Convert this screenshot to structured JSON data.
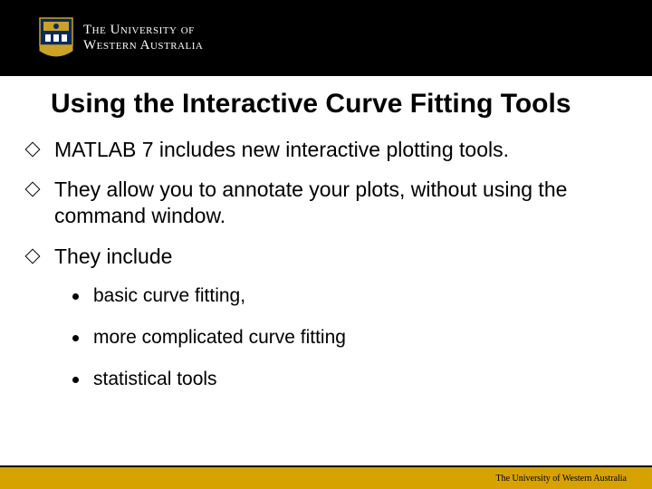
{
  "header": {
    "uni_line1": "The University of",
    "uni_line2": "Western Australia"
  },
  "title": "Using the Interactive Curve Fitting Tools",
  "bullets": [
    {
      "text": "MATLAB 7 includes new interactive plotting tools."
    },
    {
      "text": "They allow you to annotate your plots, without using the command window."
    },
    {
      "text": "They include",
      "sub": [
        "basic curve fitting,",
        "more complicated curve fitting",
        "statistical tools"
      ]
    }
  ],
  "footer": {
    "text": "The University of Western Australia"
  }
}
